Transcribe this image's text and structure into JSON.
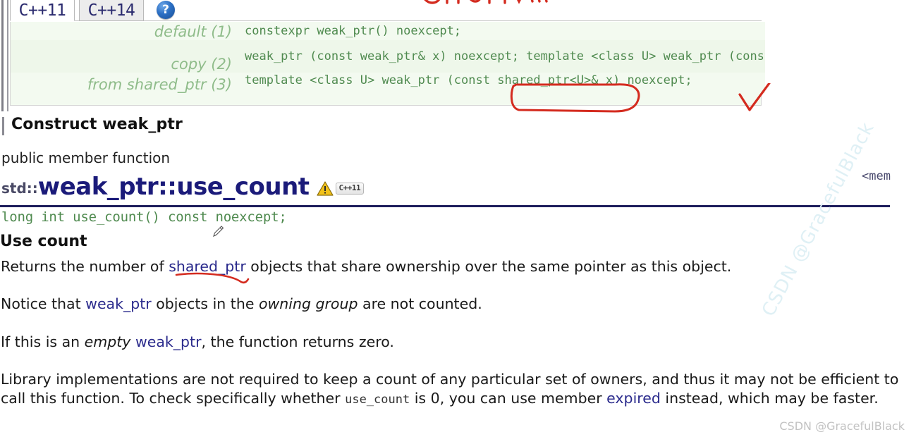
{
  "reference_panel": {
    "tabs": [
      {
        "label": "C++11",
        "active": true
      },
      {
        "label": "C++14",
        "active": false
      }
    ],
    "help_icon_label": "?",
    "signatures": [
      {
        "label": "default (1)",
        "code": "constexpr weak_ptr() noexcept;"
      },
      {
        "label": "copy (2)",
        "code": "weak_ptr (const weak_ptr& x) noexcept;\ntemplate <class U> weak_ptr (const weak_ptr<U>& x) noexcept;"
      },
      {
        "label": "from shared_ptr (3)",
        "code": "template <class U> weak_ptr (const shared_ptr<U>& x) noexcept;"
      }
    ]
  },
  "section": {
    "construct_title": "Construct weak_ptr",
    "kind": "public member function",
    "header_include": "<mem"
  },
  "title": {
    "namespace": "std::",
    "name": "weak_ptr::use_count",
    "warning_icon": "warning-triangle-icon",
    "standard_badge": "C++11"
  },
  "prototype": "long int use_count() const noexcept;",
  "body": {
    "heading": "Use count",
    "edit_icon": "pencil-icon",
    "paragraph1": {
      "before": "Returns the number of ",
      "link": "shared_ptr",
      "after": " objects that share ownership over the same pointer as this object."
    },
    "paragraph2": {
      "before": "Notice that ",
      "link": "weak_ptr",
      "middle": " objects in the ",
      "italic": "owning group",
      "after": " are not counted."
    },
    "paragraph3": {
      "before": "If this is an ",
      "italic": "empty",
      "middle": " ",
      "link": "weak_ptr",
      "after": ", the function returns zero."
    },
    "paragraph4": {
      "part1": "Library implementations are not required to keep a count of any particular set of owners, and thus it may not be efficient to call this function. To check specifically whether ",
      "mono": "use_count",
      "part2": " is ",
      "zero": "0",
      "part3": ", you can use member ",
      "link": "expired",
      "part4": " instead, which may be faster."
    }
  },
  "annotations": {
    "ink_color": "#d42b1f",
    "circle_target": "shared_ptr<U>& x",
    "checkmark": "red-check-mark",
    "underline_target": "shared_ptr"
  },
  "watermarks": {
    "diagonal": "CSDN @GracefulBlack",
    "credit": "CSDN @GracefulBlack"
  },
  "colors": {
    "code_green": "#4f8a4f",
    "label_green": "#8fbc8a",
    "title_blue": "#1b1b7a",
    "link_blue": "#2a2a8c",
    "rule_navy": "#1d1d5c",
    "panel_bg": "#f3faf0"
  }
}
